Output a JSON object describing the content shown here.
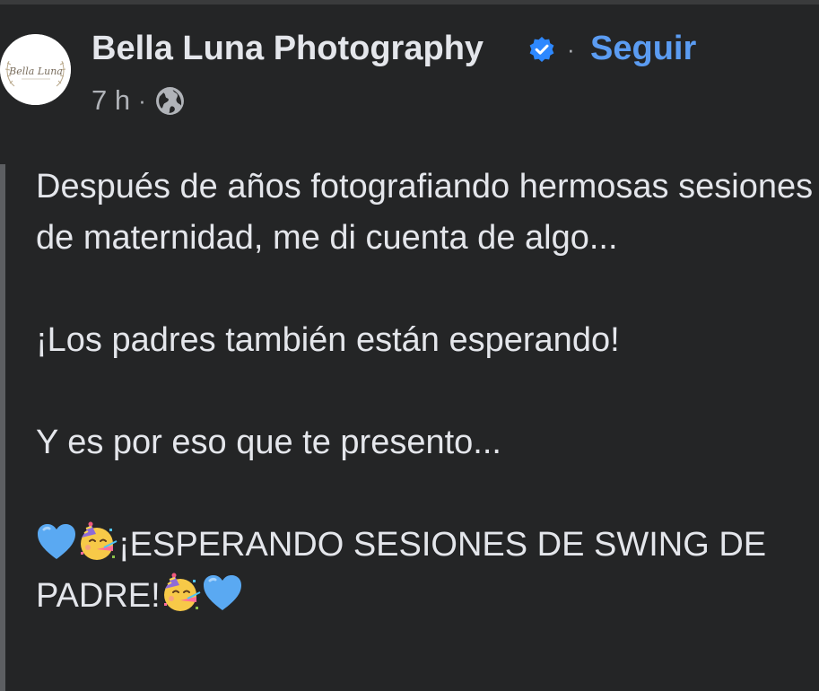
{
  "post": {
    "page_name": "Bella Luna Photography",
    "avatar_text": "Bella Luna",
    "verified_icon": "verified-badge-icon",
    "separator": "·",
    "follow_label": "Seguir",
    "time_label": "7 h",
    "meta_separator": "·",
    "audience_icon": "globe-icon",
    "body": {
      "line1": "Después de años fotografiando hermosas sesiones de maternidad, me di cuenta de algo...",
      "line2": "¡Los padres también están esperando!",
      "line3": "Y es por eso que te presento...",
      "line4": "¡ESPERANDO SESIONES DE SWING DE PADRE!"
    },
    "emoji_icons": [
      "blue-heart-icon",
      "partying-face-icon"
    ],
    "colors": {
      "background": "#242526",
      "text": "#e4e6eb",
      "secondary_text": "#b0b3b8",
      "link_blue": "#5b9cf2",
      "verified_blue": "#2d88ff"
    }
  }
}
